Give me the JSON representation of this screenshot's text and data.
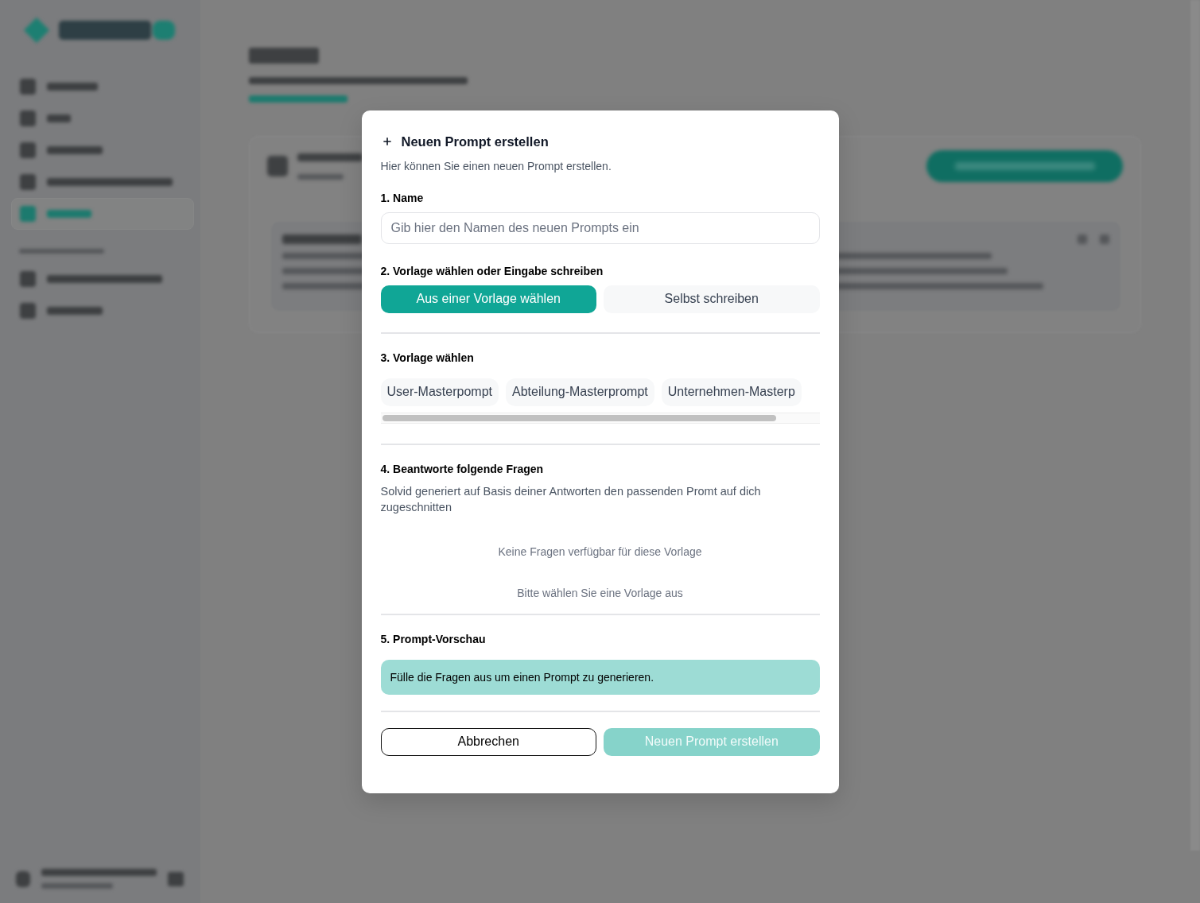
{
  "dialog": {
    "title": "Neuen Prompt erstellen",
    "subtitle": "Hier können Sie einen neuen Prompt erstellen.",
    "name_section": {
      "label": "1. Name",
      "placeholder": "Gib hier den Namen des neuen Prompts ein"
    },
    "mode_section": {
      "label": "2. Vorlage wählen oder Eingabe schreiben",
      "options": [
        {
          "label": "Aus einer Vorlage wählen",
          "selected": true
        },
        {
          "label": "Selbst schreiben",
          "selected": false
        }
      ]
    },
    "template_section": {
      "label": "3. Vorlage wählen",
      "templates": [
        {
          "label": "User-Masterpompt",
          "selected": false
        },
        {
          "label": "Abteilung-Masterprompt",
          "selected": false
        },
        {
          "label": "Unternehmen-Masterp",
          "selected": false
        }
      ]
    },
    "questions_section": {
      "label": "4. Beantworte folgende Fragen",
      "description": "Solvid generiert auf Basis deiner Antworten den passenden Promt auf dich zugeschnitten",
      "empty_message": "Keine Fragen verfügbar für diese Vorlage",
      "hint": "Bitte wählen Sie eine Vorlage aus"
    },
    "preview_section": {
      "label": "5. Prompt-Vorschau",
      "text": "Fülle die Fragen aus um einen Prompt zu generieren."
    },
    "buttons": [
      {
        "label": "Abbrechen",
        "kind": "secondary",
        "disabled": false
      },
      {
        "label": "Neuen Prompt erstellen",
        "kind": "primary",
        "disabled": true
      }
    ]
  }
}
